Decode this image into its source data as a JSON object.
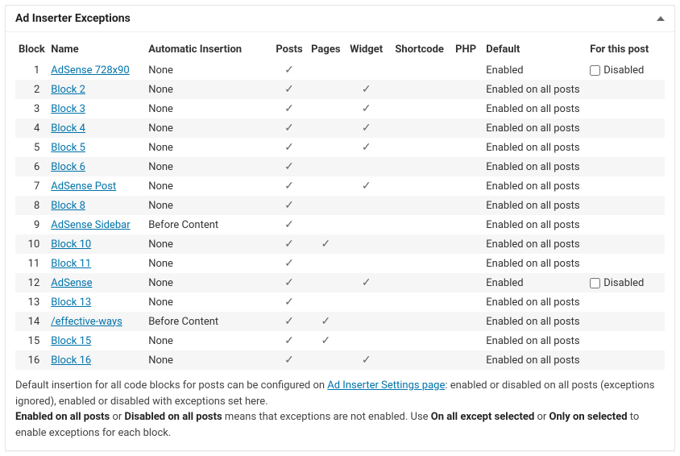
{
  "panel": {
    "title": "Ad Inserter Exceptions"
  },
  "headers": {
    "block": "Block",
    "name": "Name",
    "auto": "Automatic Insertion",
    "posts": "Posts",
    "pages": "Pages",
    "widget": "Widget",
    "shortcode": "Shortcode",
    "php": "PHP",
    "default": "Default",
    "forthis": "For this post"
  },
  "rows": [
    {
      "block": "1",
      "name": "AdSense 728x90",
      "auto": "None",
      "posts": true,
      "pages": false,
      "widget": false,
      "shortcode": false,
      "php": false,
      "default": "Enabled",
      "disabled_label": "Disabled",
      "show_checkbox": true
    },
    {
      "block": "2",
      "name": "Block 2",
      "auto": "None",
      "posts": true,
      "pages": false,
      "widget": true,
      "shortcode": false,
      "php": false,
      "default": "Enabled on all posts",
      "show_checkbox": false
    },
    {
      "block": "3",
      "name": "Block 3",
      "auto": "None",
      "posts": true,
      "pages": false,
      "widget": true,
      "shortcode": false,
      "php": false,
      "default": "Enabled on all posts",
      "show_checkbox": false
    },
    {
      "block": "4",
      "name": "Block 4",
      "auto": "None",
      "posts": true,
      "pages": false,
      "widget": true,
      "shortcode": false,
      "php": false,
      "default": "Enabled on all posts",
      "show_checkbox": false
    },
    {
      "block": "5",
      "name": "Block 5",
      "auto": "None",
      "posts": true,
      "pages": false,
      "widget": true,
      "shortcode": false,
      "php": false,
      "default": "Enabled on all posts",
      "show_checkbox": false
    },
    {
      "block": "6",
      "name": "Block 6",
      "auto": "None",
      "posts": true,
      "pages": false,
      "widget": false,
      "shortcode": false,
      "php": false,
      "default": "Enabled on all posts",
      "show_checkbox": false
    },
    {
      "block": "7",
      "name": "AdSense Post",
      "auto": "None",
      "posts": true,
      "pages": false,
      "widget": true,
      "shortcode": false,
      "php": false,
      "default": "Enabled on all posts",
      "show_checkbox": false
    },
    {
      "block": "8",
      "name": "Block 8",
      "auto": "None",
      "posts": true,
      "pages": false,
      "widget": false,
      "shortcode": false,
      "php": false,
      "default": "Enabled on all posts",
      "show_checkbox": false
    },
    {
      "block": "9",
      "name": "AdSense Sidebar",
      "auto": "Before Content",
      "posts": true,
      "pages": false,
      "widget": false,
      "shortcode": false,
      "php": false,
      "default": "Enabled on all posts",
      "show_checkbox": false
    },
    {
      "block": "10",
      "name": "Block 10",
      "auto": "None",
      "posts": true,
      "pages": true,
      "widget": false,
      "shortcode": false,
      "php": false,
      "default": "Enabled on all posts",
      "show_checkbox": false
    },
    {
      "block": "11",
      "name": "Block 11",
      "auto": "None",
      "posts": true,
      "pages": false,
      "widget": false,
      "shortcode": false,
      "php": false,
      "default": "Enabled on all posts",
      "show_checkbox": false
    },
    {
      "block": "12",
      "name": "AdSense",
      "auto": "None",
      "posts": true,
      "pages": false,
      "widget": true,
      "shortcode": false,
      "php": false,
      "default": "Enabled",
      "disabled_label": "Disabled",
      "show_checkbox": true
    },
    {
      "block": "13",
      "name": "Block 13",
      "auto": "None",
      "posts": true,
      "pages": false,
      "widget": false,
      "shortcode": false,
      "php": false,
      "default": "Enabled on all posts",
      "show_checkbox": false
    },
    {
      "block": "14",
      "name": "/effective-ways",
      "auto": "Before Content",
      "posts": true,
      "pages": true,
      "widget": false,
      "shortcode": false,
      "php": false,
      "default": "Enabled on all posts",
      "show_checkbox": false
    },
    {
      "block": "15",
      "name": "Block 15",
      "auto": "None",
      "posts": true,
      "pages": true,
      "widget": false,
      "shortcode": false,
      "php": false,
      "default": "Enabled on all posts",
      "show_checkbox": false
    },
    {
      "block": "16",
      "name": "Block 16",
      "auto": "None",
      "posts": true,
      "pages": false,
      "widget": true,
      "shortcode": false,
      "php": false,
      "default": "Enabled on all posts",
      "show_checkbox": false
    }
  ],
  "footer": {
    "text1a": "Default insertion for all code blocks for posts can be configured on ",
    "link_text": "Ad Inserter Settings page",
    "text1b": ": enabled or disabled on all posts (exceptions ignored), enabled or disabled with exceptions set here.",
    "strong1": "Enabled on all posts",
    "text2a": " or ",
    "strong2": "Disabled on all posts",
    "text2b": " means that exceptions are not enabled. Use ",
    "strong3": "On all except selected",
    "text2c": " or ",
    "strong4": "Only on selected",
    "text2d": " to enable exceptions for each block."
  },
  "checkmark": "✓"
}
